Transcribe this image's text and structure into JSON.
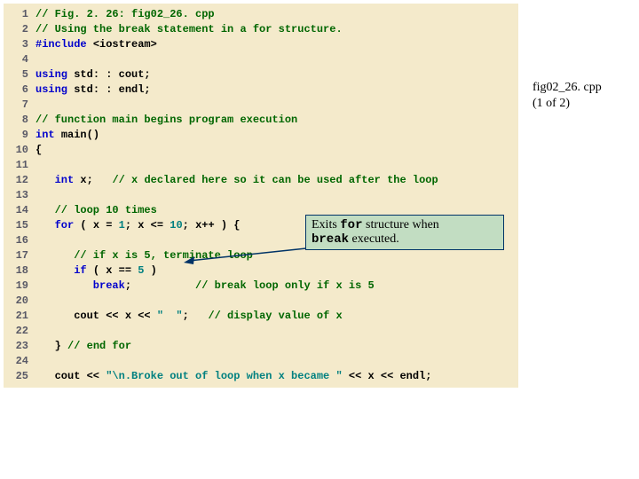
{
  "caption": {
    "title": "fig02_26. cpp",
    "sub": "(1 of 2)"
  },
  "callout": {
    "p1a": "Exits ",
    "p1b": "for",
    "p1c": " structure when",
    "p2a": "break",
    "p2b": " executed."
  },
  "lines": {
    "n1": "1",
    "n2": "2",
    "n3": "3",
    "n4": "4",
    "n5": "5",
    "n6": "6",
    "n7": "7",
    "n8": "8",
    "n9": "9",
    "n10": "10",
    "n11": "11",
    "n12": "12",
    "n13": "13",
    "n14": "14",
    "n15": "15",
    "n16": "16",
    "n17": "17",
    "n18": "18",
    "n19": "19",
    "n20": "20",
    "n21": "21",
    "n22": "22",
    "n23": "23",
    "n24": "24",
    "n25": "25",
    "c1": "// Fig. 2. 26: fig02_26. cpp",
    "c2": "// Using the break statement in a for structure.",
    "c3a": "#include ",
    "c3b": "<iostream>",
    "c5a": "using ",
    "c5b": "std: : cout;",
    "c6a": "using ",
    "c6b": "std: : endl;",
    "c8": "// function main begins program execution",
    "c9a": "int ",
    "c9b": "main()",
    "c10": "{",
    "c12a": "   int ",
    "c12b": "x;   ",
    "c12c": "// x declared here so it can be used after the loop",
    "c14": "   // loop 10 times",
    "c15a": "   for ",
    "c15b": "( x = ",
    "c15c": "1",
    "c15d": "; x <= ",
    "c15e": "10",
    "c15f": "; x++ ) {",
    "c17": "      // if x is 5, terminate loop",
    "c18a": "      if ",
    "c18b": "( x == ",
    "c18c": "5",
    "c18d": " )",
    "c19a": "         break",
    "c19b": ";          ",
    "c19c": "// break loop only if x is 5",
    "c21a": "      cout << x << ",
    "c21b": "\"  \"",
    "c21c": ";   ",
    "c21d": "// display value of x",
    "c23a": "   } ",
    "c23b": "// end for",
    "c25a": "   cout << ",
    "c25b": "\"\\n.Broke out of loop when x became \"",
    "c25c": " << x << endl;"
  }
}
